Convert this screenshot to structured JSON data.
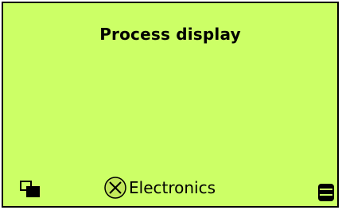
{
  "display": {
    "title": "Process display",
    "background_color": "#ccff66"
  },
  "footer": {
    "left_icon": "window-switch-icon",
    "status_icon": "error-x-icon",
    "status_text": "Electronics",
    "right_icon": "menu-icon"
  }
}
